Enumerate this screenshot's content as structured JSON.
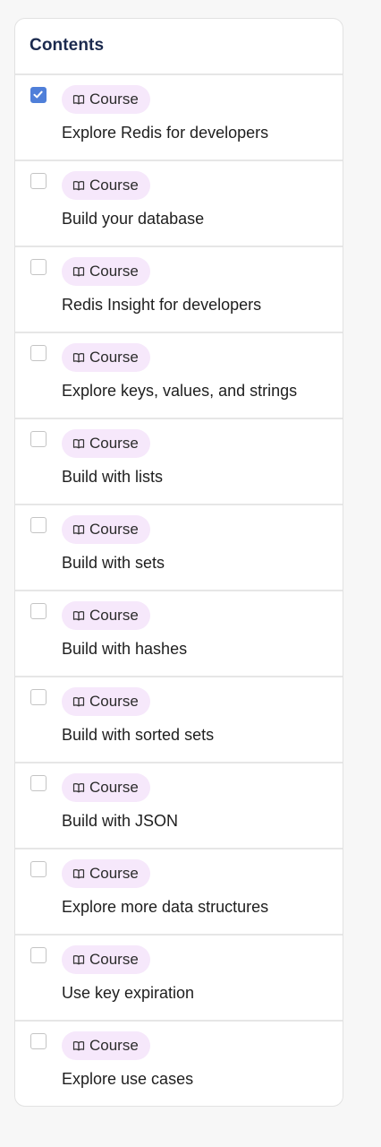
{
  "header": {
    "title": "Contents"
  },
  "badge_icon": "open-book-icon",
  "colors": {
    "accent": "#4f7fd9",
    "badge_bg": "#f6e8fb",
    "title": "#1b2a4e"
  },
  "items": [
    {
      "type": "Course",
      "title": "Explore Redis for developers",
      "checked": true
    },
    {
      "type": "Course",
      "title": "Build your database",
      "checked": false
    },
    {
      "type": "Course",
      "title": "Redis Insight for developers",
      "checked": false
    },
    {
      "type": "Course",
      "title": "Explore keys, values, and strings",
      "checked": false
    },
    {
      "type": "Course",
      "title": "Build with lists",
      "checked": false
    },
    {
      "type": "Course",
      "title": "Build with sets",
      "checked": false
    },
    {
      "type": "Course",
      "title": "Build with hashes",
      "checked": false
    },
    {
      "type": "Course",
      "title": "Build with sorted sets",
      "checked": false
    },
    {
      "type": "Course",
      "title": "Build with JSON",
      "checked": false
    },
    {
      "type": "Course",
      "title": "Explore more data structures",
      "checked": false
    },
    {
      "type": "Course",
      "title": "Use key expiration",
      "checked": false
    },
    {
      "type": "Course",
      "title": "Explore use cases",
      "checked": false
    }
  ]
}
